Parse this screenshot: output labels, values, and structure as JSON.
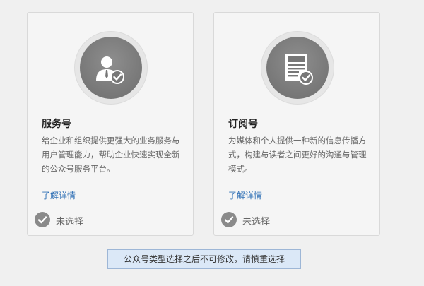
{
  "cards": [
    {
      "title": "服务号",
      "description": "给企业和组织提供更强大的业务服务与用户管理能力，帮助企业快速实现全新的公众号服务平台。",
      "link_label": "了解详情",
      "status_label": "未选择",
      "icon": "user-check-icon"
    },
    {
      "title": "订阅号",
      "description": "为媒体和个人提供一种新的信息传播方式，构建与读者之间更好的沟通与管理模式。",
      "link_label": "了解详情",
      "status_label": "未选择",
      "icon": "document-check-icon"
    }
  ],
  "notice": "公众号类型选择之后不可修改，请慎重选择",
  "colors": {
    "link": "#2e6fb5",
    "badge": "#7a7a7a",
    "notice_bg": "#dbe8f7",
    "notice_border": "#9db6d6"
  }
}
